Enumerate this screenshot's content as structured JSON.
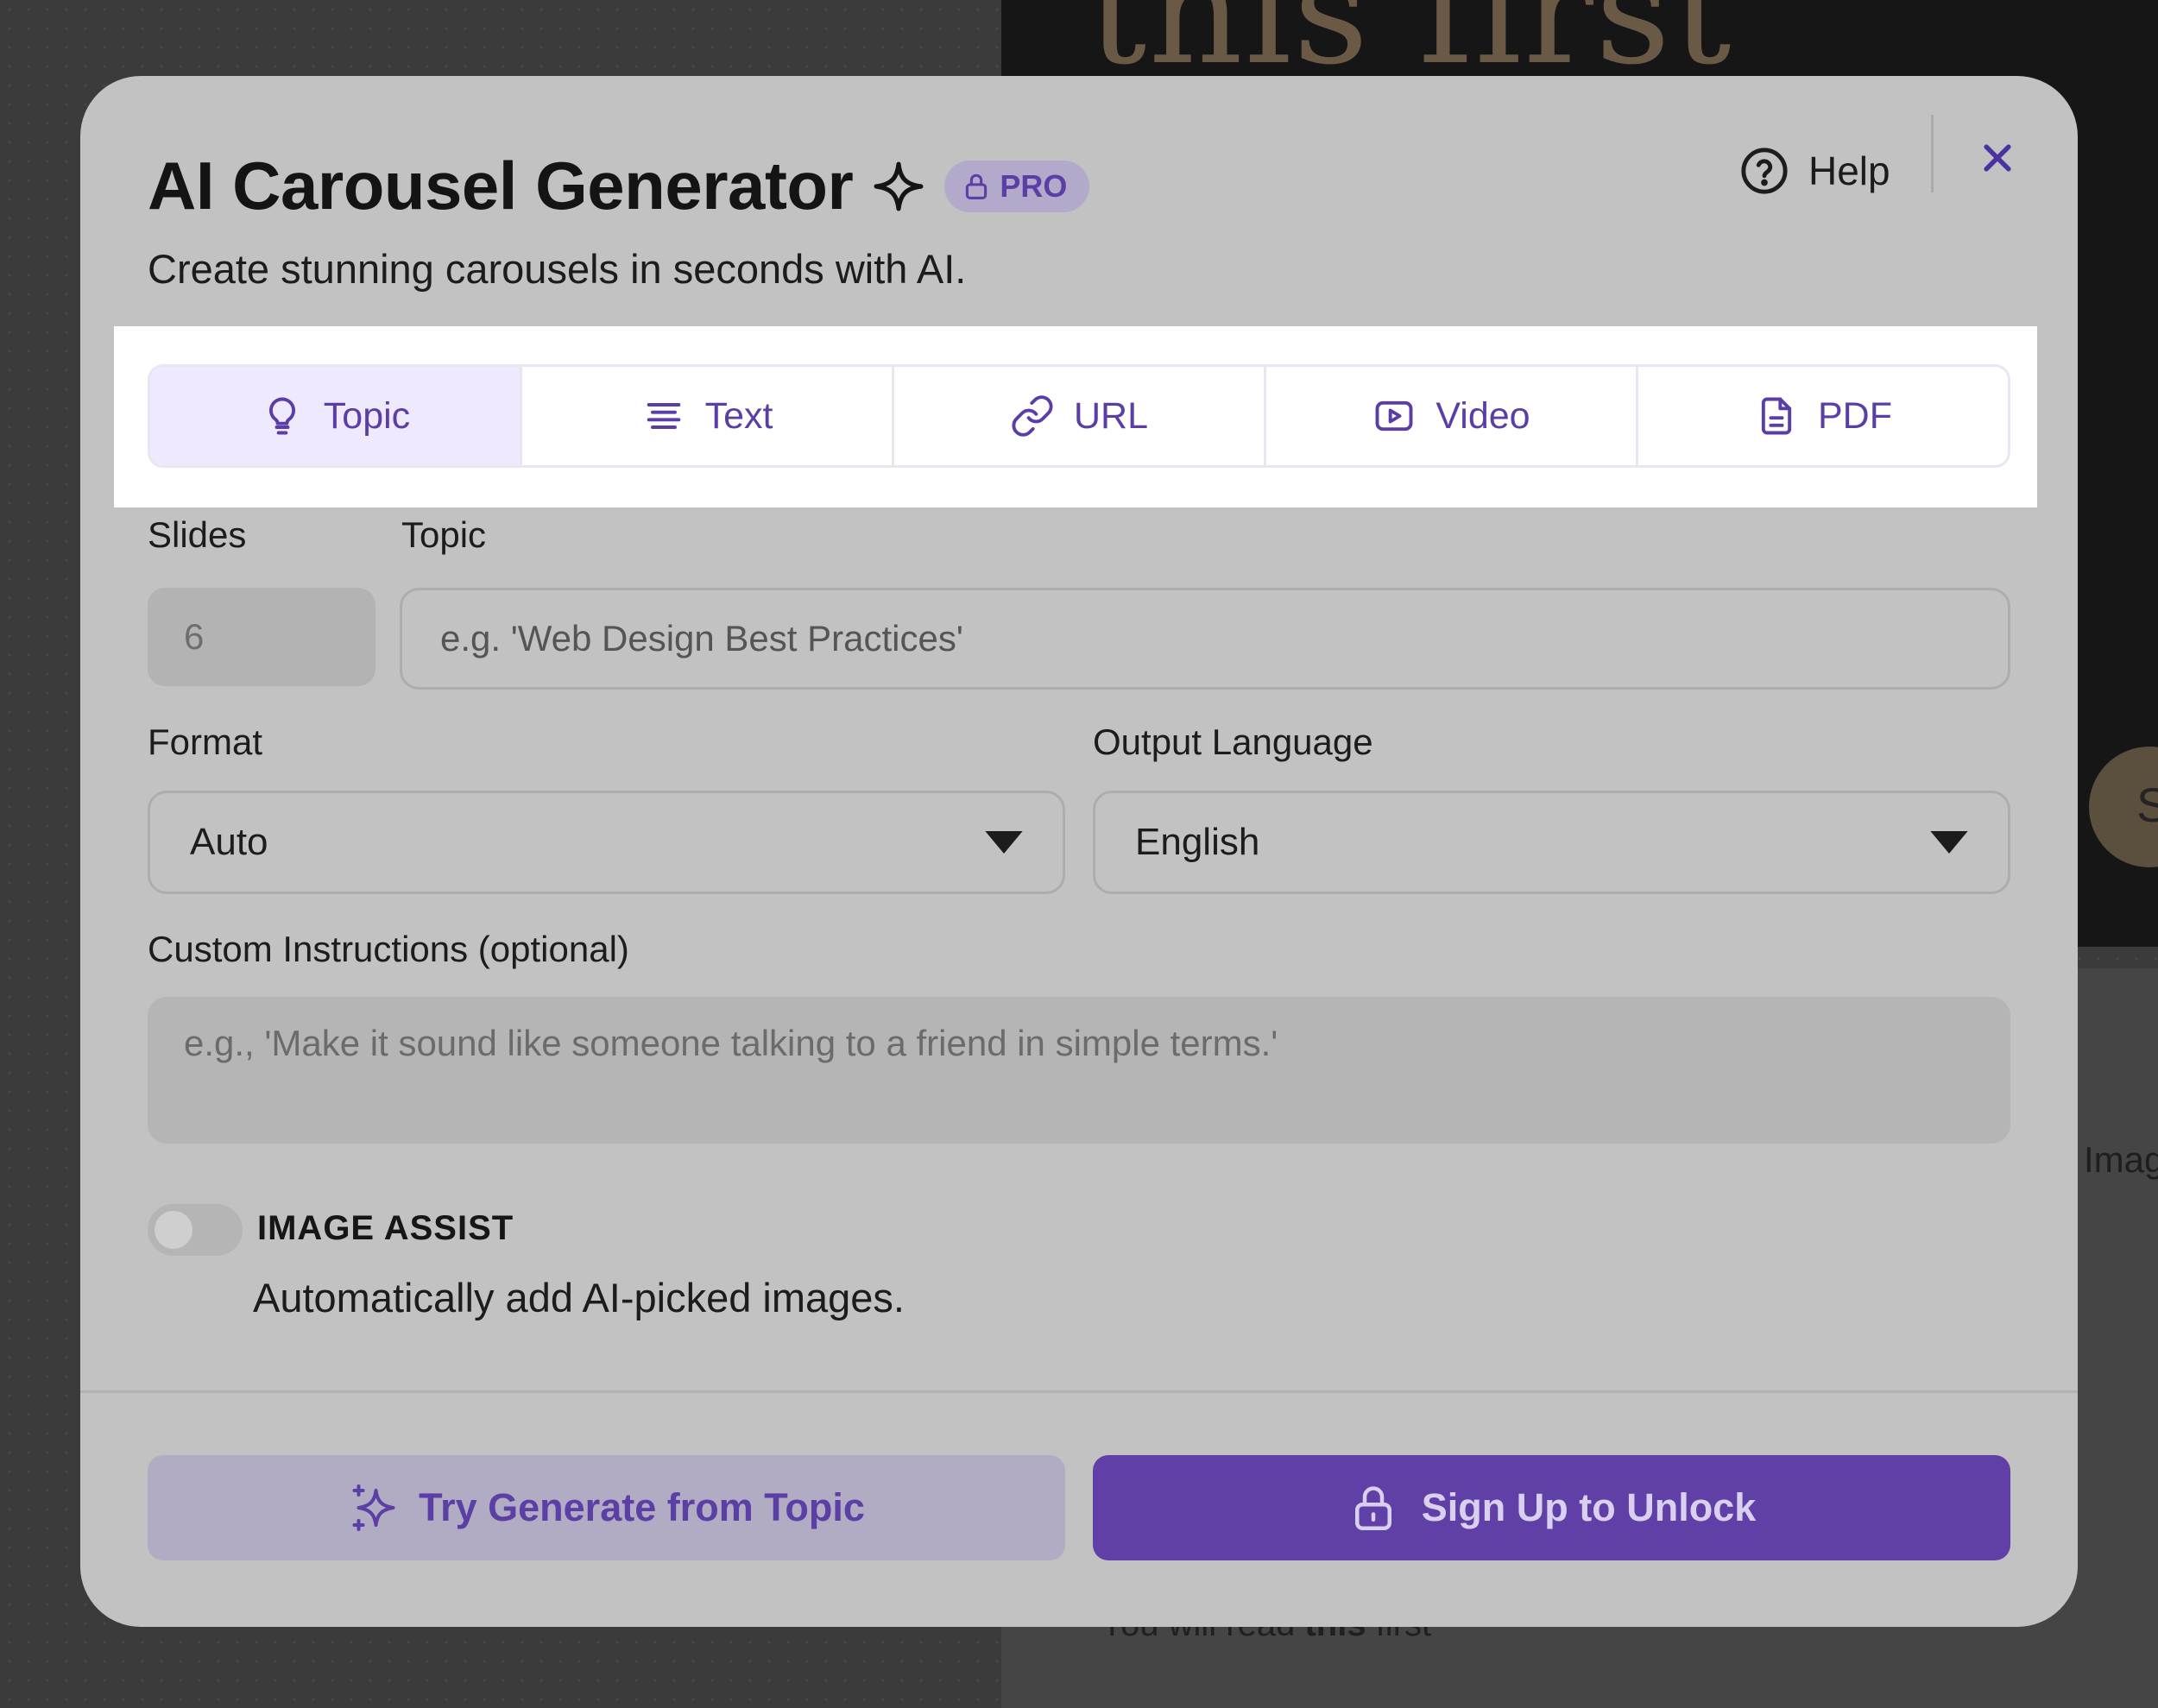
{
  "background": {
    "headline": "this first",
    "circle_letter": "S",
    "side_text": "Imag",
    "bottom_text_pre": "You will read ",
    "bottom_text_bold": "this",
    "bottom_text_post": " first"
  },
  "modal": {
    "title": "AI Carousel Generator",
    "badge": "PRO",
    "subtitle": "Create stunning carousels in seconds with AI.",
    "help_label": "Help",
    "tabs": [
      {
        "label": "Topic",
        "icon": "lightbulb-icon",
        "active": true
      },
      {
        "label": "Text",
        "icon": "text-lines-icon",
        "active": false
      },
      {
        "label": "URL",
        "icon": "link-icon",
        "active": false
      },
      {
        "label": "Video",
        "icon": "video-icon",
        "active": false
      },
      {
        "label": "PDF",
        "icon": "document-icon",
        "active": false
      }
    ]
  },
  "form": {
    "slides_label": "Slides",
    "slides_value": "6",
    "topic_label": "Topic",
    "topic_placeholder": "e.g. 'Web Design Best Practices'",
    "format_label": "Format",
    "format_value": "Auto",
    "language_label": "Output Language",
    "language_value": "English",
    "instructions_label": "Custom Instructions (optional)",
    "instructions_placeholder": "e.g., 'Make it sound like someone talking to a friend in simple terms.'",
    "image_assist_title": "IMAGE ASSIST",
    "image_assist_desc": "Automatically add AI-picked images.",
    "image_assist_on": false
  },
  "footer": {
    "try_label": "Try Generate from Topic",
    "signup_label": "Sign Up to Unlock"
  },
  "colors": {
    "accent": "#6040a6",
    "accent_text": "#5a3ea6",
    "modal_bg": "#c2c2c2",
    "active_tab_bg": "#efe9fd"
  }
}
